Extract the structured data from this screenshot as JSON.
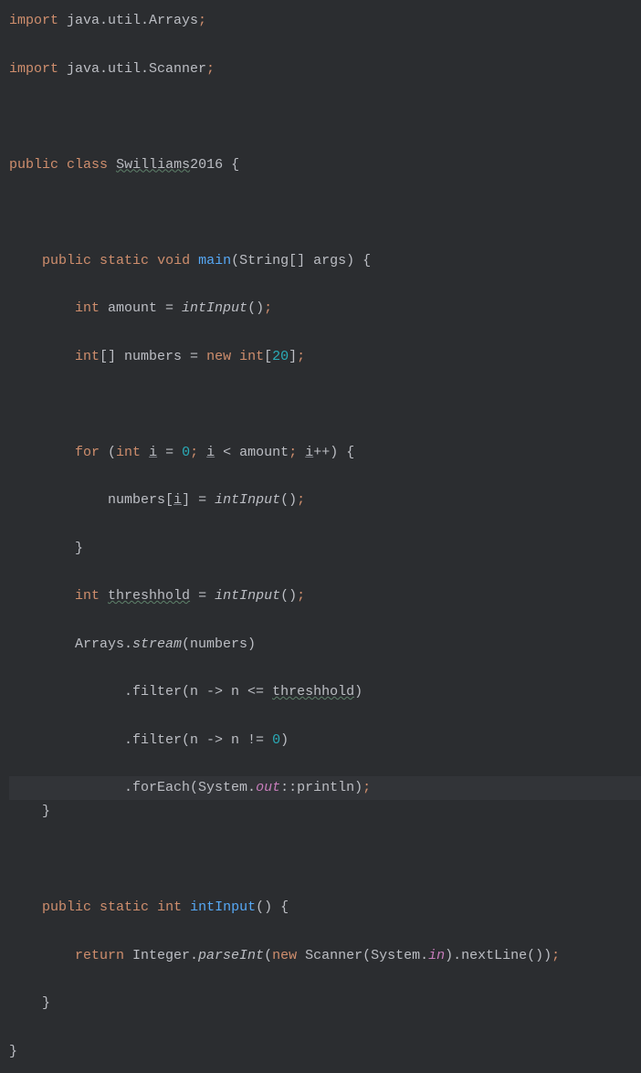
{
  "code": {
    "import1_kw": "import",
    "import1_pkg": " java.util.Arrays",
    "import2_kw": "import",
    "import2_pkg": " java.util.Scanner",
    "class_kw1": "public",
    "class_kw2": "class",
    "class_name": "Swilliams",
    "class_suffix": "2016 {",
    "main_kw1": "public",
    "main_kw2": "static",
    "main_kw3": "void",
    "main_name": "main",
    "main_params": "(String[] args) {",
    "line_int_amount_kw": "int",
    "line_int_amount_var": " amount = ",
    "line_int_amount_call": "intInput",
    "line_int_amount_end": "()",
    "line_intarr_kw": "int",
    "line_intarr_mid": "[] numbers = ",
    "line_intarr_new": "new",
    "line_intarr_type": " int",
    "line_intarr_bracket_open": "[",
    "line_intarr_num": "20",
    "line_intarr_bracket_close": "]",
    "for_kw": "for",
    "for_open": " (",
    "for_int": "int",
    "for_i1": "i",
    "for_eq": " = ",
    "for_zero": "0",
    "for_semi1": ";",
    "for_i2": "i",
    "for_lt": " < amount",
    "for_semi2": ";",
    "for_i3": "i",
    "for_inc": "++) {",
    "for_body_var": "numbers[",
    "for_body_i": "i",
    "for_body_mid": "] = ",
    "for_body_call": "intInput",
    "for_body_end": "()",
    "for_close": "}",
    "thresh_kw": "int",
    "thresh_var": "threshhold",
    "thresh_eq": " = ",
    "thresh_call": "intInput",
    "thresh_end": "()",
    "arrays_cls": "Arrays.",
    "arrays_stream": "stream",
    "arrays_stream_args": "(numbers)",
    "filter1_pre": ".filter(n -> n <= ",
    "filter1_var": "threshhold",
    "filter1_end": ")",
    "filter2_pre": ".filter(n -> n != ",
    "filter2_num": "0",
    "filter2_end": ")",
    "foreach_pre": ".forEach(System.",
    "foreach_out": "out",
    "foreach_mid": "::println)",
    "main_close": "}",
    "intinput_kw1": "public",
    "intinput_kw2": "static",
    "intinput_kw3": "int",
    "intinput_name": "intInput",
    "intinput_params": "() {",
    "return_kw": "return",
    "return_mid1": " Integer.",
    "return_parseint": "parseInt",
    "return_mid2": "(",
    "return_new": "new",
    "return_scanner": " Scanner(System.",
    "return_in": "in",
    "return_end": ").nextLine())",
    "intinput_close": "}",
    "class_close": "}"
  }
}
